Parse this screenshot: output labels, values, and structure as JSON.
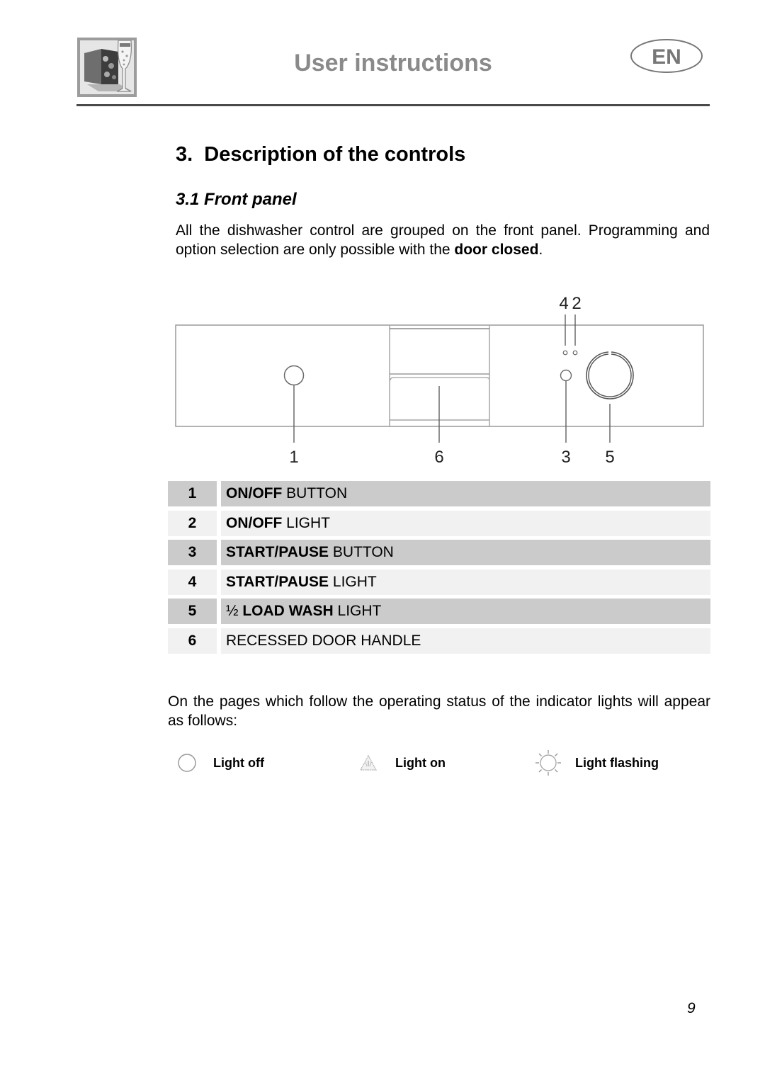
{
  "header": {
    "title": "User instructions",
    "language_badge": "EN",
    "logo_icon": "dishwasher-and-glass-logo"
  },
  "section": {
    "title": "3.  Description of the controls",
    "subsection_title": "3.1 Front panel",
    "intro_text": "All the dishwasher control are grouped on the front panel. Programming and option selection are only possible with the ",
    "intro_bold": "door closed",
    "intro_end": "."
  },
  "diagram": {
    "callouts": [
      {
        "number": "1",
        "part": "on-off-button"
      },
      {
        "number": "6",
        "part": "recessed-door-handle"
      },
      {
        "number": "3",
        "part": "start-pause-button"
      },
      {
        "number": "5",
        "part": "half-load-wash-light"
      },
      {
        "number": "4",
        "part": "start-pause-light"
      },
      {
        "number": "2",
        "part": "on-off-light"
      }
    ]
  },
  "controls": [
    {
      "number": "1",
      "bold": "ON/OFF",
      "normal": " BUTTON",
      "prefix": ""
    },
    {
      "number": "2",
      "bold": "ON/OFF",
      "normal": " LIGHT",
      "prefix": ""
    },
    {
      "number": "3",
      "bold": "START/PAUSE",
      "normal": " BUTTON",
      "prefix": ""
    },
    {
      "number": "4",
      "bold": "START/PAUSE",
      "normal": " LIGHT",
      "prefix": ""
    },
    {
      "number": "5",
      "bold": "LOAD WASH",
      "normal": " LIGHT",
      "prefix": "½ "
    },
    {
      "number": "6",
      "bold": "",
      "normal": "RECESSED DOOR HANDLE",
      "prefix": ""
    }
  ],
  "status_text": "On the pages which follow the operating status of the indicator lights will appear as follows:",
  "indicators": [
    {
      "icon": "light-off-icon",
      "label": "Light off"
    },
    {
      "icon": "light-on-icon",
      "label": "Light on"
    },
    {
      "icon": "light-flashing-icon",
      "label": "Light flashing"
    }
  ],
  "page_number": "9",
  "colors": {
    "header_title": "#8a8a8a",
    "table_dark_row": "#cbcbcb",
    "table_light_row": "#f1f1f1"
  }
}
